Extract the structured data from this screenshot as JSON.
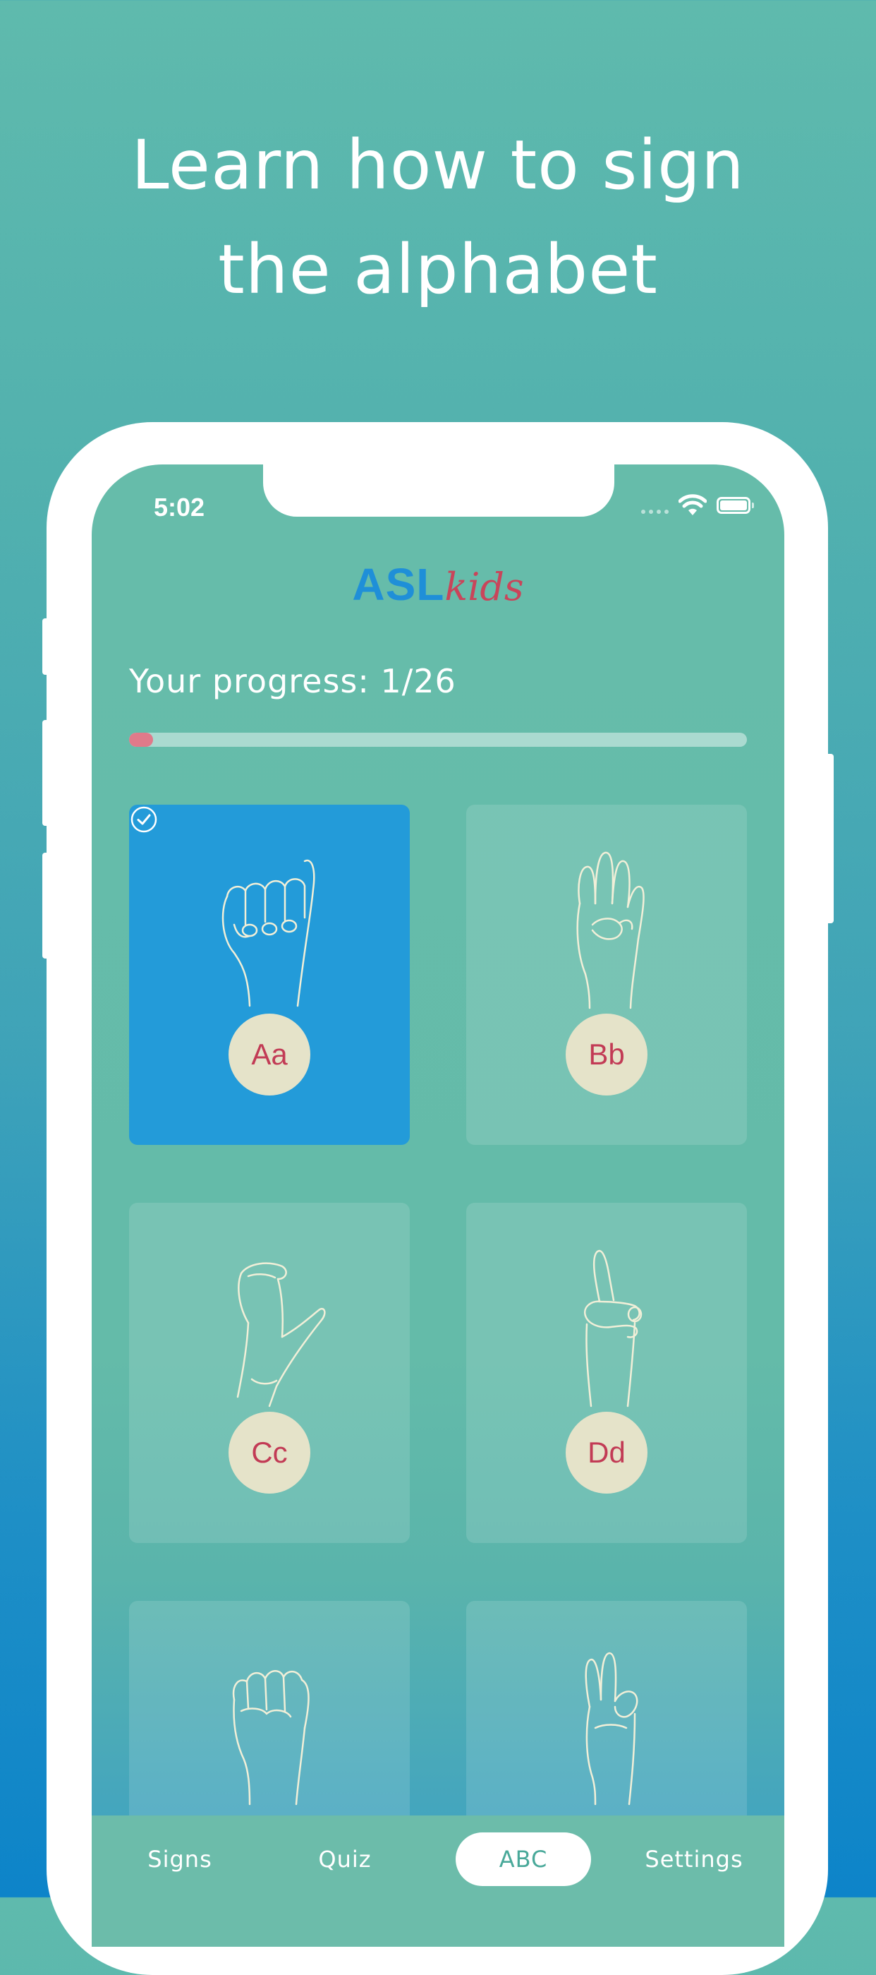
{
  "promo": {
    "title_line1": "Learn how to sign",
    "title_line2": "the alphabet"
  },
  "status_bar": {
    "time": "5:02",
    "icons": [
      "signal-icon",
      "wifi-icon",
      "battery-icon"
    ]
  },
  "header": {
    "logo_primary": "ASL",
    "logo_secondary": "kids"
  },
  "progress": {
    "label": "Your progress: 1/26",
    "completed": 1,
    "total": 26,
    "fraction": 0.0385
  },
  "cards": [
    {
      "letter": "Aa",
      "completed": true,
      "icon": "hand-sign-a-icon"
    },
    {
      "letter": "Bb",
      "completed": false,
      "icon": "hand-sign-b-icon"
    },
    {
      "letter": "Cc",
      "completed": false,
      "icon": "hand-sign-c-icon"
    },
    {
      "letter": "Dd",
      "completed": false,
      "icon": "hand-sign-d-icon"
    },
    {
      "letter": "",
      "completed": false,
      "icon": "hand-sign-e-icon"
    },
    {
      "letter": "",
      "completed": false,
      "icon": "hand-sign-f-icon"
    }
  ],
  "tabs": [
    {
      "label": "Signs",
      "selected": false
    },
    {
      "label": "Quiz",
      "selected": false
    },
    {
      "label": "ABC",
      "selected": true
    },
    {
      "label": "Settings",
      "selected": false
    }
  ],
  "colors": {
    "active_card": "#239bd9",
    "badge_bg": "#e5e3c9",
    "badge_text": "#c23b55",
    "progress_fill": "#e07a8a",
    "logo_blue": "#1f8fd8",
    "logo_red": "#c9455a"
  }
}
